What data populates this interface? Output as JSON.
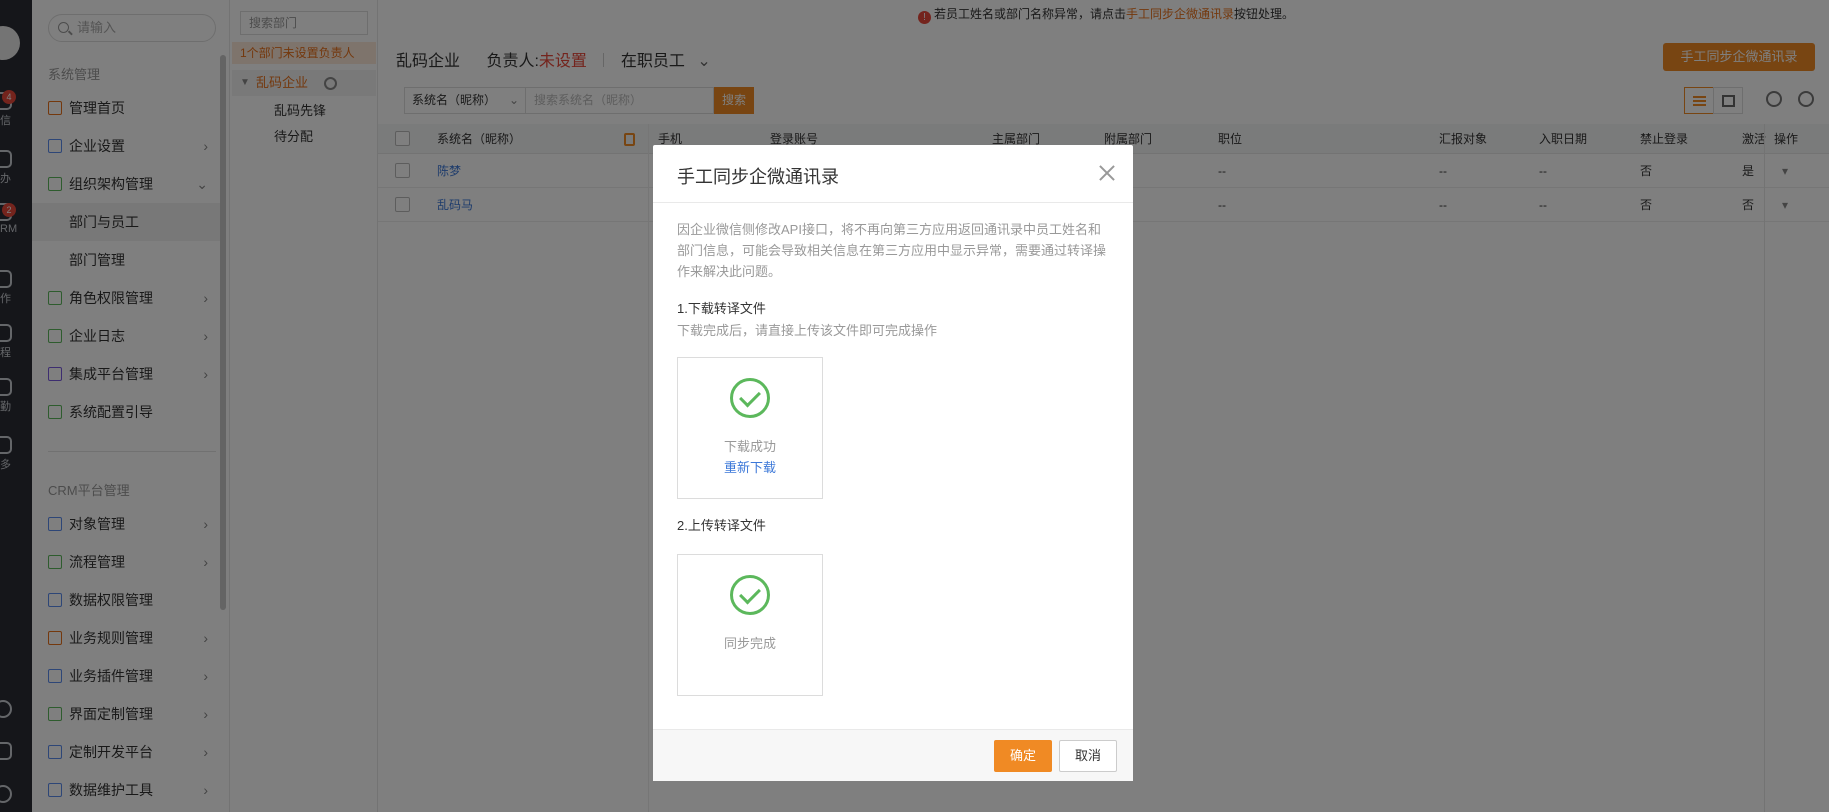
{
  "rail": {
    "items": [
      {
        "label": "信",
        "badge": "4",
        "icon": "chat-icon"
      },
      {
        "label": "办",
        "icon": "todo-icon"
      },
      {
        "label": "RM",
        "badge": "2",
        "icon": "crm-icon"
      },
      {
        "label": "作",
        "icon": "work-icon"
      },
      {
        "label": "程",
        "icon": "schedule-icon"
      },
      {
        "label": "勤",
        "icon": "attendance-icon"
      },
      {
        "label": "多",
        "icon": "more-icon"
      }
    ]
  },
  "sidebar": {
    "search_placeholder": "请输入",
    "section1": "系统管理",
    "items": [
      {
        "label": "管理首页",
        "icon": "home-icon"
      },
      {
        "label": "企业设置",
        "icon": "building-icon",
        "arrow": "›"
      },
      {
        "label": "组织架构管理",
        "icon": "org-icon",
        "arrow": "⌄"
      },
      {
        "label": "部门与员工"
      },
      {
        "label": "部门管理"
      },
      {
        "label": "角色权限管理",
        "icon": "role-icon",
        "arrow": "›"
      },
      {
        "label": "企业日志",
        "icon": "log-icon",
        "arrow": "›"
      },
      {
        "label": "集成平台管理",
        "icon": "integration-icon",
        "arrow": "›"
      },
      {
        "label": "系统配置引导",
        "icon": "guide-icon"
      }
    ],
    "section2": "CRM平台管理",
    "items2": [
      {
        "label": "对象管理",
        "icon": "object-icon",
        "arrow": "›"
      },
      {
        "label": "流程管理",
        "icon": "flow-icon",
        "arrow": "›"
      },
      {
        "label": "数据权限管理",
        "icon": "data-permission-icon"
      },
      {
        "label": "业务规则管理",
        "icon": "rule-icon",
        "arrow": "›"
      },
      {
        "label": "业务插件管理",
        "icon": "plugin-icon",
        "arrow": "›"
      },
      {
        "label": "界面定制管理",
        "icon": "ui-custom-icon",
        "arrow": "›"
      },
      {
        "label": "定制开发平台",
        "icon": "dev-icon",
        "arrow": "›"
      },
      {
        "label": "数据维护工具",
        "icon": "maintenance-icon",
        "arrow": "›"
      }
    ]
  },
  "dept": {
    "search_placeholder": "搜索部门",
    "warning": "1个部门未设置负责人",
    "root": "乱码企业",
    "children": [
      "乱码先锋",
      "待分配"
    ]
  },
  "main": {
    "notice_prefix": "若员工姓名或部门名称异常，请点击",
    "notice_link": "手工同步企微通讯录",
    "notice_suffix": "按钮处理。",
    "sync_button": "手工同步企微通讯录",
    "company": "乱码企业",
    "owner_label": "负责人:",
    "owner_value": "未设置",
    "employee_filter": "在职员工",
    "filter_field": "系统名（昵称）",
    "filter_placeholder": "搜索系统名（昵称）",
    "filter_button": "搜索",
    "columns": [
      "系统名（昵称）",
      "手机",
      "登录账号",
      "主属部门",
      "附属部门",
      "职位",
      "汇报对象",
      "入职日期",
      "禁止登录",
      "激活",
      "操作"
    ],
    "rows": [
      {
        "name": "陈梦",
        "position": "--",
        "report": "--",
        "join": "--",
        "ban": "否",
        "active": "是"
      },
      {
        "name": "乱码马",
        "position": "--",
        "report": "--",
        "join": "--",
        "ban": "否",
        "active": "否"
      }
    ]
  },
  "modal": {
    "title": "手工同步企微通讯录",
    "description": "因企业微信侧修改API接口，将不再向第三方应用返回通讯录中员工姓名和部门信息，可能会导致相关信息在第三方应用中显示异常，需要通过转译操作来解决此问题。",
    "step1_title": "1.下载转译文件",
    "step1_sub": "下载完成后，请直接上传该文件即可完成操作",
    "step1_status": "下载成功",
    "step1_link": "重新下载",
    "step2_title": "2.上传转译文件",
    "step2_status": "同步完成",
    "ok": "确定",
    "cancel": "取消"
  }
}
